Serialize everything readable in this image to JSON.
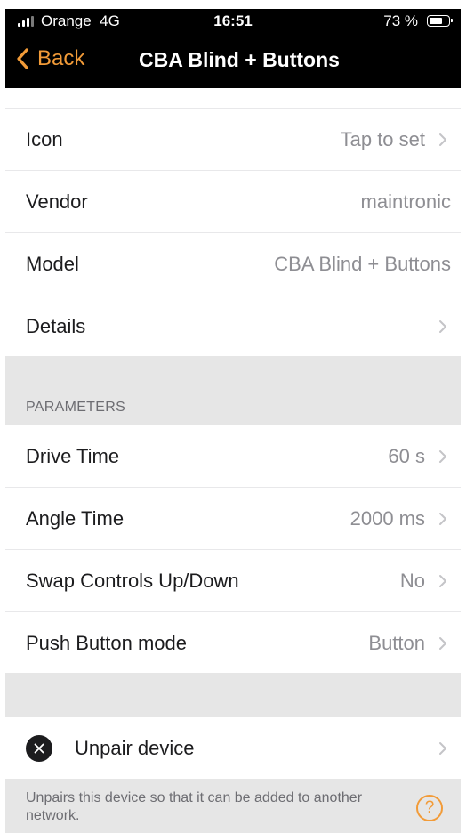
{
  "status": {
    "carrier": "Orange",
    "network": "4G",
    "time": "16:51",
    "battery": "73 %",
    "battery_level": 0.73
  },
  "nav": {
    "back_label": "Back",
    "title": "CBA Blind + Buttons"
  },
  "info_rows": [
    {
      "label": "Icon",
      "value": "Tap to set"
    },
    {
      "label": "Vendor",
      "value": "maintronic"
    },
    {
      "label": "Model",
      "value": "CBA Blind + Buttons"
    },
    {
      "label": "Details",
      "value": ""
    }
  ],
  "parameters": {
    "header": "PARAMETERS",
    "rows": [
      {
        "label": "Drive Time",
        "value": "60 s"
      },
      {
        "label": "Angle Time",
        "value": "2000 ms"
      },
      {
        "label": "Swap Controls Up/Down",
        "value": "No"
      },
      {
        "label": "Push Button mode",
        "value": "Button"
      }
    ]
  },
  "unpair": {
    "label": "Unpair device",
    "footer": "Unpairs this device so that it can be added to another network.",
    "help_glyph": "?"
  },
  "colors": {
    "accent": "#f29b38",
    "secondary_text": "#8e8e93",
    "separator_bg": "#e6e6e6"
  }
}
